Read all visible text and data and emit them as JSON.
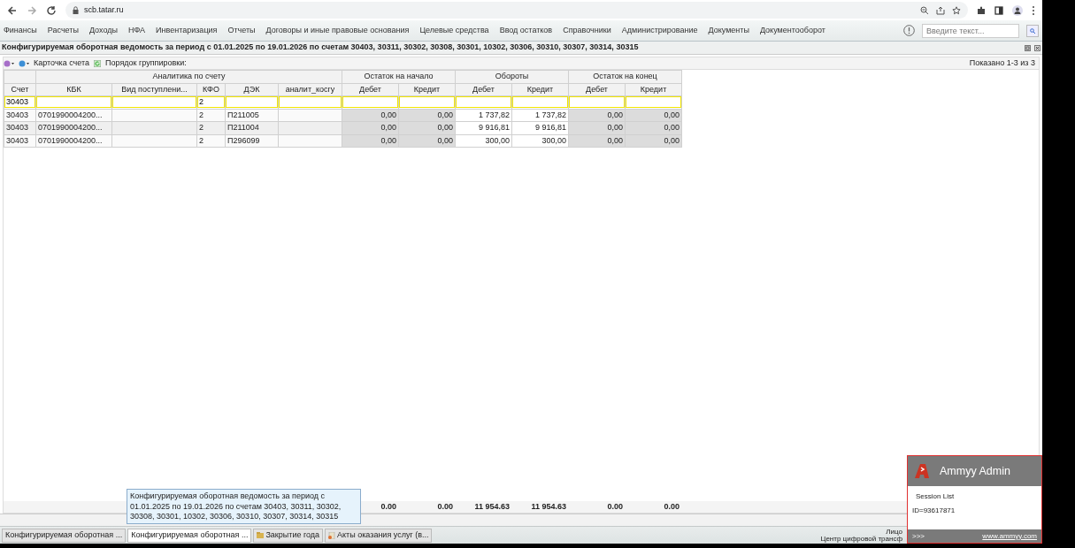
{
  "browser": {
    "url": "scb.tatar.ru"
  },
  "menu": [
    "Финансы",
    "Расчеты",
    "Доходы",
    "НФА",
    "Инвентаризация",
    "Отчеты",
    "Договоры и иные правовые основания",
    "Целевые средства",
    "Ввод остатков",
    "Справочники",
    "Администрирование",
    "Документы",
    "Документооборот"
  ],
  "search": {
    "placeholder": "Введите текст..."
  },
  "report_title": "Конфигурируемая оборотная ведомость за период с 01.01.2025 по 19.01.2026 по счетам 30403, 30311, 30302, 30308, 30301, 10302, 30306, 30310, 30307, 30314, 30315",
  "toolbar": {
    "card_label": "Карточка счета",
    "grouping_label": "Порядок группировки:",
    "shown": "Показано 1-3 из 3"
  },
  "table": {
    "groups": [
      "Аналитика по счету",
      "Остаток на начало",
      "Обороты",
      "Остаток на конец"
    ],
    "columns": [
      {
        "label": "Счет",
        "filter": "30403"
      },
      {
        "label": "КБК"
      },
      {
        "label": "Вид поступлени..."
      },
      {
        "label": "КФО",
        "filter": "2"
      },
      {
        "label": "ДЭК"
      },
      {
        "label": "аналит_косгу"
      },
      {
        "label": "Дебет"
      },
      {
        "label": "Кредит"
      },
      {
        "label": "Дебет"
      },
      {
        "label": "Кредит"
      },
      {
        "label": "Дебет"
      },
      {
        "label": "Кредит"
      }
    ],
    "rows": [
      [
        "30403",
        "0701990004200...",
        "",
        "2",
        "П211005",
        "",
        "0,00",
        "0,00",
        "1 737,82",
        "1 737,82",
        "0,00",
        "0,00"
      ],
      [
        "30403",
        "0701990004200...",
        "",
        "2",
        "П211004",
        "",
        "0,00",
        "0,00",
        "9 916,81",
        "9 916,81",
        "0,00",
        "0,00"
      ],
      [
        "30403",
        "0701990004200...",
        "",
        "2",
        "П296099",
        "",
        "0,00",
        "0,00",
        "300,00",
        "300,00",
        "0,00",
        "0,00"
      ]
    ],
    "totals": [
      "0.00",
      "0.00",
      "11 954.63",
      "11 954.63",
      "0.00",
      "0.00"
    ]
  },
  "tooltip": "Конфигурируемая оборотная ведомость за период с 01.01.2025 по 19.01.2026 по счетам 30403, 30311, 30302, 30308, 30301, 10302, 30306, 30310, 30307, 30314, 30315",
  "tabs": [
    {
      "label": "Конфигурируемая оборотная ...",
      "selected": false
    },
    {
      "label": "Конфигурируемая оборотная ...",
      "selected": true
    },
    {
      "label": "Закрытие года",
      "selected": false,
      "kind": "folder"
    },
    {
      "label": "Акты оказания услуг (в...",
      "selected": false,
      "kind": "document"
    }
  ],
  "footer": [
    "Лицо",
    "Центр цифровой трансф"
  ],
  "ammyy": {
    "title": "Ammyy Admin",
    "session_list": "Session List",
    "id": "ID=93617871",
    "more": ">>>",
    "link": "www.ammyy.com"
  }
}
